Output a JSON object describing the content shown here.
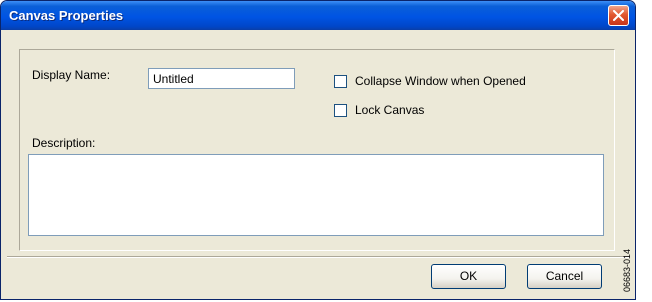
{
  "window": {
    "title": "Canvas Properties",
    "close_icon": "close-x-icon"
  },
  "form": {
    "display_name_label": "Display Name:",
    "display_name_value": "Untitled",
    "collapse_window_label": "Collapse Window when Opened",
    "collapse_window_checked": false,
    "lock_canvas_label": "Lock Canvas",
    "lock_canvas_checked": false,
    "description_label": "Description:",
    "description_value": ""
  },
  "buttons": {
    "ok_label": "OK",
    "cancel_label": "Cancel"
  },
  "figure_id": "06683-014",
  "colors": {
    "titlebar": "#0054e3",
    "dialog_bg": "#ece9d8",
    "close_button": "#e2582f",
    "input_border": "#7f9db9"
  }
}
